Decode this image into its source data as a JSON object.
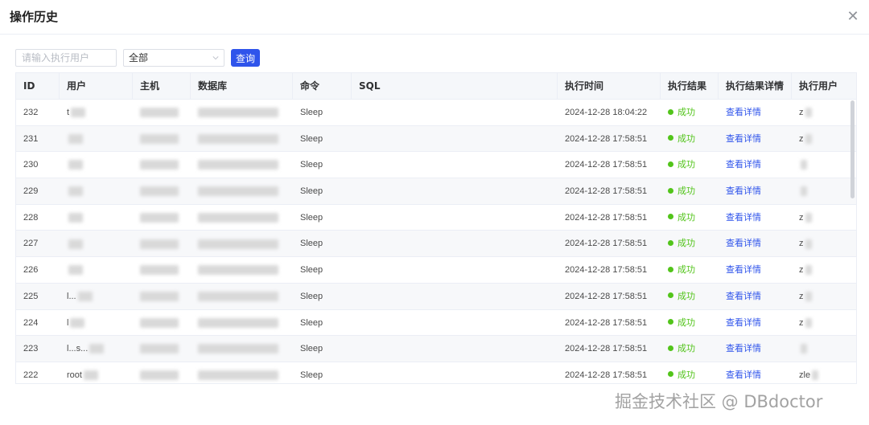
{
  "dialog": {
    "title": "操作历史",
    "close_icon": "close-icon"
  },
  "filters": {
    "user_placeholder": "请输入执行用户",
    "type_value": "全部",
    "query_label": "查询"
  },
  "table": {
    "columns": [
      "ID",
      "用户",
      "主机",
      "数据库",
      "命令",
      "SQL",
      "执行时间",
      "执行结果",
      "执行结果详情",
      "执行用户"
    ],
    "rows": [
      {
        "id": "232",
        "user": "t",
        "command": "Sleep",
        "time": "2024-12-28 18:04:22",
        "result": "成功",
        "detail": "查看详情",
        "exec_user": "z"
      },
      {
        "id": "231",
        "user": "",
        "command": "Sleep",
        "time": "2024-12-28 17:58:51",
        "result": "成功",
        "detail": "查看详情",
        "exec_user": "z"
      },
      {
        "id": "230",
        "user": "",
        "command": "Sleep",
        "time": "2024-12-28 17:58:51",
        "result": "成功",
        "detail": "查看详情",
        "exec_user": ""
      },
      {
        "id": "229",
        "user": "",
        "command": "Sleep",
        "time": "2024-12-28 17:58:51",
        "result": "成功",
        "detail": "查看详情",
        "exec_user": ""
      },
      {
        "id": "228",
        "user": "",
        "command": "Sleep",
        "time": "2024-12-28 17:58:51",
        "result": "成功",
        "detail": "查看详情",
        "exec_user": "z"
      },
      {
        "id": "227",
        "user": "",
        "command": "Sleep",
        "time": "2024-12-28 17:58:51",
        "result": "成功",
        "detail": "查看详情",
        "exec_user": "z"
      },
      {
        "id": "226",
        "user": "",
        "command": "Sleep",
        "time": "2024-12-28 17:58:51",
        "result": "成功",
        "detail": "查看详情",
        "exec_user": "z"
      },
      {
        "id": "225",
        "user": "l...",
        "command": "Sleep",
        "time": "2024-12-28 17:58:51",
        "result": "成功",
        "detail": "查看详情",
        "exec_user": "z"
      },
      {
        "id": "224",
        "user": "l",
        "command": "Sleep",
        "time": "2024-12-28 17:58:51",
        "result": "成功",
        "detail": "查看详情",
        "exec_user": "z"
      },
      {
        "id": "223",
        "user": "l...s...",
        "command": "Sleep",
        "time": "2024-12-28 17:58:51",
        "result": "成功",
        "detail": "查看详情",
        "exec_user": ""
      },
      {
        "id": "222",
        "user": "root",
        "command": "Sleep",
        "time": "2024-12-28 17:58:51",
        "result": "成功",
        "detail": "查看详情",
        "exec_user": "zle"
      }
    ]
  },
  "watermark": "掘金技术社区 @ DBdoctor",
  "colors": {
    "primary": "#2f54eb",
    "success": "#52c41a",
    "header_bg": "#f5f7fa",
    "row_alt_bg": "#f7f8fa"
  }
}
